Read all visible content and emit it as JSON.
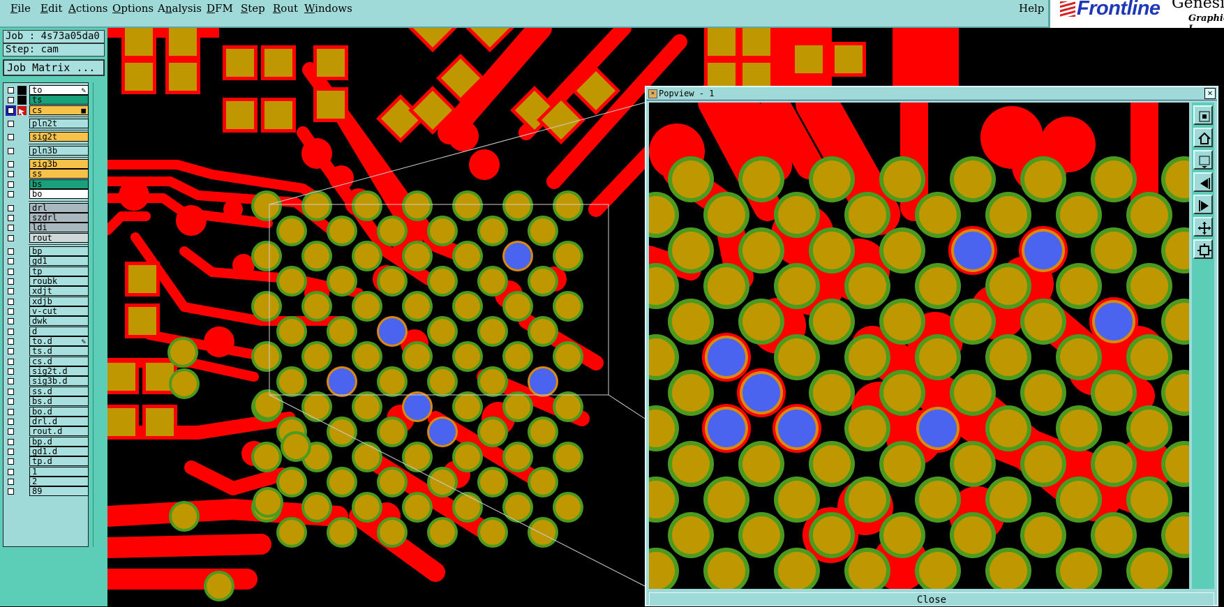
{
  "menubar": {
    "items": [
      {
        "label": "File",
        "ul": "F"
      },
      {
        "label": "Edit",
        "ul": "E"
      },
      {
        "label": "Actions",
        "ul": "A"
      },
      {
        "label": "Options",
        "ul": "O"
      },
      {
        "label": "Analysis",
        "ul": "n"
      },
      {
        "label": "DFM",
        "ul": "D"
      },
      {
        "label": "Step",
        "ul": "S"
      },
      {
        "label": "Rout",
        "ul": "R"
      },
      {
        "label": "Windows",
        "ul": "W"
      }
    ],
    "help_label": "Help"
  },
  "brand": {
    "logo": "Frontline",
    "product": "Genesis",
    "subtitle": "Graphic I"
  },
  "job": {
    "job_text": "Job : 4s73a05da0",
    "step_text": "Step: cam",
    "matrix_button": "Job Matrix ..."
  },
  "layers": [
    {
      "name": "to",
      "color": "#ffffff",
      "mark": "✎",
      "group": 1
    },
    {
      "name": "ts",
      "color": "#1aa07a",
      "group": 1
    },
    {
      "name": "cs",
      "color": "#f6c24a",
      "mark": "■",
      "active": true,
      "group": 1
    },
    {
      "name": "pln2t",
      "color": "#a8e0df",
      "group": 2
    },
    {
      "name": "sig2t",
      "color": "#f6c24a",
      "group": 3
    },
    {
      "name": "pln3b",
      "color": "#a8e0df",
      "group": 4
    },
    {
      "name": "sig3b",
      "color": "#f6c24a",
      "group": 5
    },
    {
      "name": "ss",
      "color": "#f6c24a",
      "group": 5
    },
    {
      "name": "bs",
      "color": "#1aa07a",
      "group": 5
    },
    {
      "name": "bo",
      "color": "#ffffff",
      "group": 5
    },
    {
      "name": "drl",
      "color": "#a9b7bf",
      "group": 6
    },
    {
      "name": "szdrl",
      "color": "#a9b7bf",
      "group": 6
    },
    {
      "name": "ldi",
      "color": "#a9b7bf",
      "group": 6
    },
    {
      "name": "rout",
      "color": "#cfd8d8",
      "group": 6
    },
    {
      "name": "bp",
      "color": "#a8e0df",
      "group": 7
    },
    {
      "name": "gd1",
      "color": "#a8e0df",
      "group": 7
    },
    {
      "name": "tp",
      "color": "#a8e0df",
      "group": 7
    },
    {
      "name": "roubk",
      "color": "#a8e0df",
      "group": 7
    },
    {
      "name": "xdjt",
      "color": "#a8e0df",
      "group": 7
    },
    {
      "name": "xdjb",
      "color": "#a8e0df",
      "group": 7
    },
    {
      "name": "v-cut",
      "color": "#a8e0df",
      "group": 7
    },
    {
      "name": "dwk",
      "color": "#a8e0df",
      "group": 7
    },
    {
      "name": "d",
      "color": "#a8e0df",
      "group": 7
    },
    {
      "name": "to.d",
      "color": "#a8e0df",
      "mark": "✎",
      "group": 7
    },
    {
      "name": "ts.d",
      "color": "#a8e0df",
      "group": 7
    },
    {
      "name": "cs.d",
      "color": "#a8e0df",
      "group": 7
    },
    {
      "name": "sig2t.d",
      "color": "#a8e0df",
      "group": 7
    },
    {
      "name": "sig3b.d",
      "color": "#a8e0df",
      "group": 7
    },
    {
      "name": "ss.d",
      "color": "#a8e0df",
      "group": 7
    },
    {
      "name": "bs.d",
      "color": "#a8e0df",
      "group": 7
    },
    {
      "name": "bo.d",
      "color": "#a8e0df",
      "group": 7
    },
    {
      "name": "drl.d",
      "color": "#a8e0df",
      "group": 7
    },
    {
      "name": "rout.d",
      "color": "#a8e0df",
      "group": 7
    },
    {
      "name": "bp.d",
      "color": "#a8e0df",
      "group": 7
    },
    {
      "name": "gd1.d",
      "color": "#a8e0df",
      "group": 7
    },
    {
      "name": "tp.d",
      "color": "#a8e0df",
      "group": 7
    },
    {
      "name": "1",
      "color": "#a8e0df",
      "group": 7
    },
    {
      "name": "2",
      "color": "#a8e0df",
      "group": 7
    },
    {
      "name": "89",
      "color": "#a8e0df",
      "group": 7
    }
  ],
  "colors": {
    "copper": "#ff0000",
    "pad_fill": "#bf9700",
    "pad_ring": "#4c9a1e",
    "via_fill": "#4a64f0",
    "via_ring": "#d88a10",
    "background": "#000000",
    "panel": "#9fd9d8"
  },
  "popview": {
    "title": "Popview - 1",
    "close_label": "Close",
    "tools": [
      "zoom-fit-icon",
      "zoom-home-icon",
      "zoom-prev-icon",
      "pan-left-icon",
      "pan-right-icon",
      "zoom-in-icon",
      "zoom-out-icon"
    ]
  }
}
